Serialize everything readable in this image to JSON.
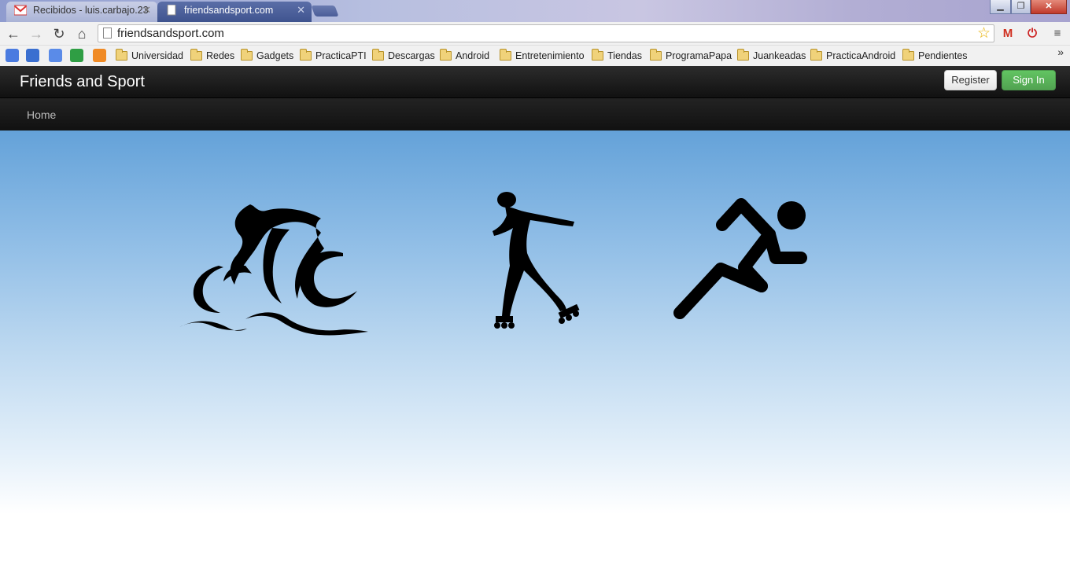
{
  "browser": {
    "tabs": [
      {
        "label": "Recibidos - luis.carbajo.23",
        "active": false
      },
      {
        "label": "friendsandsport.com",
        "active": true
      }
    ],
    "url": "friendsandsport.com",
    "bookmarks": [
      "Universidad",
      "Redes",
      "Gadgets",
      "PracticaPTI",
      "Descargas",
      "Android",
      "Entretenimiento",
      "Tiendas",
      "ProgramaPapa",
      "Juankeadas",
      "PracticaAndroid",
      "Pendientes"
    ]
  },
  "site": {
    "brand": "Friends and Sport",
    "register_label": "Register",
    "signin_label": "Sign In",
    "nav_home": "Home",
    "sports": [
      "triathlon-icon",
      "inline-skater-icon",
      "runner-icon"
    ]
  },
  "colors": {
    "navbar": "#1b1b1b",
    "signin_green": "#5bb75b",
    "hero_top": "#64a2d9",
    "hero_bottom": "#ffffff"
  }
}
